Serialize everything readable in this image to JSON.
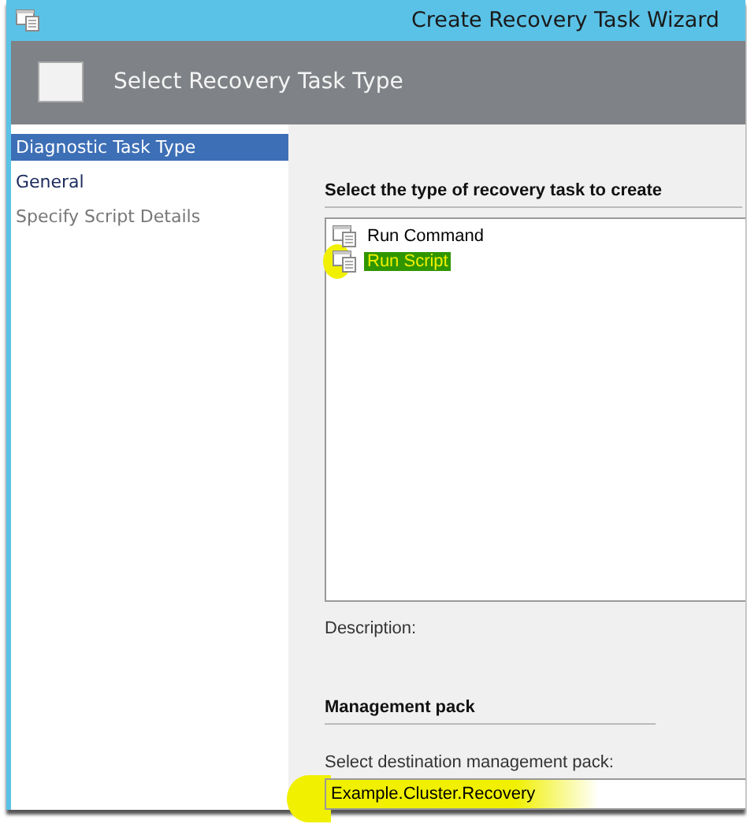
{
  "window": {
    "title": "Create Recovery Task Wizard"
  },
  "header": {
    "title": "Select Recovery Task Type"
  },
  "steps": [
    {
      "label": "Diagnostic Task Type",
      "selected": true,
      "disabled": false
    },
    {
      "label": "General",
      "selected": false,
      "disabled": false
    },
    {
      "label": "Specify Script Details",
      "selected": false,
      "disabled": true
    }
  ],
  "task_type": {
    "heading": "Select the type of recovery task to create",
    "items": [
      {
        "label": "Run Command",
        "selected": false,
        "highlighted": false
      },
      {
        "label": "Run Script",
        "selected": true,
        "highlighted": true
      }
    ]
  },
  "description": {
    "label": "Description:"
  },
  "management_pack": {
    "heading": "Management pack",
    "field_label": "Select destination management pack:",
    "value": "Example.Cluster.Recovery",
    "highlighted": true
  }
}
